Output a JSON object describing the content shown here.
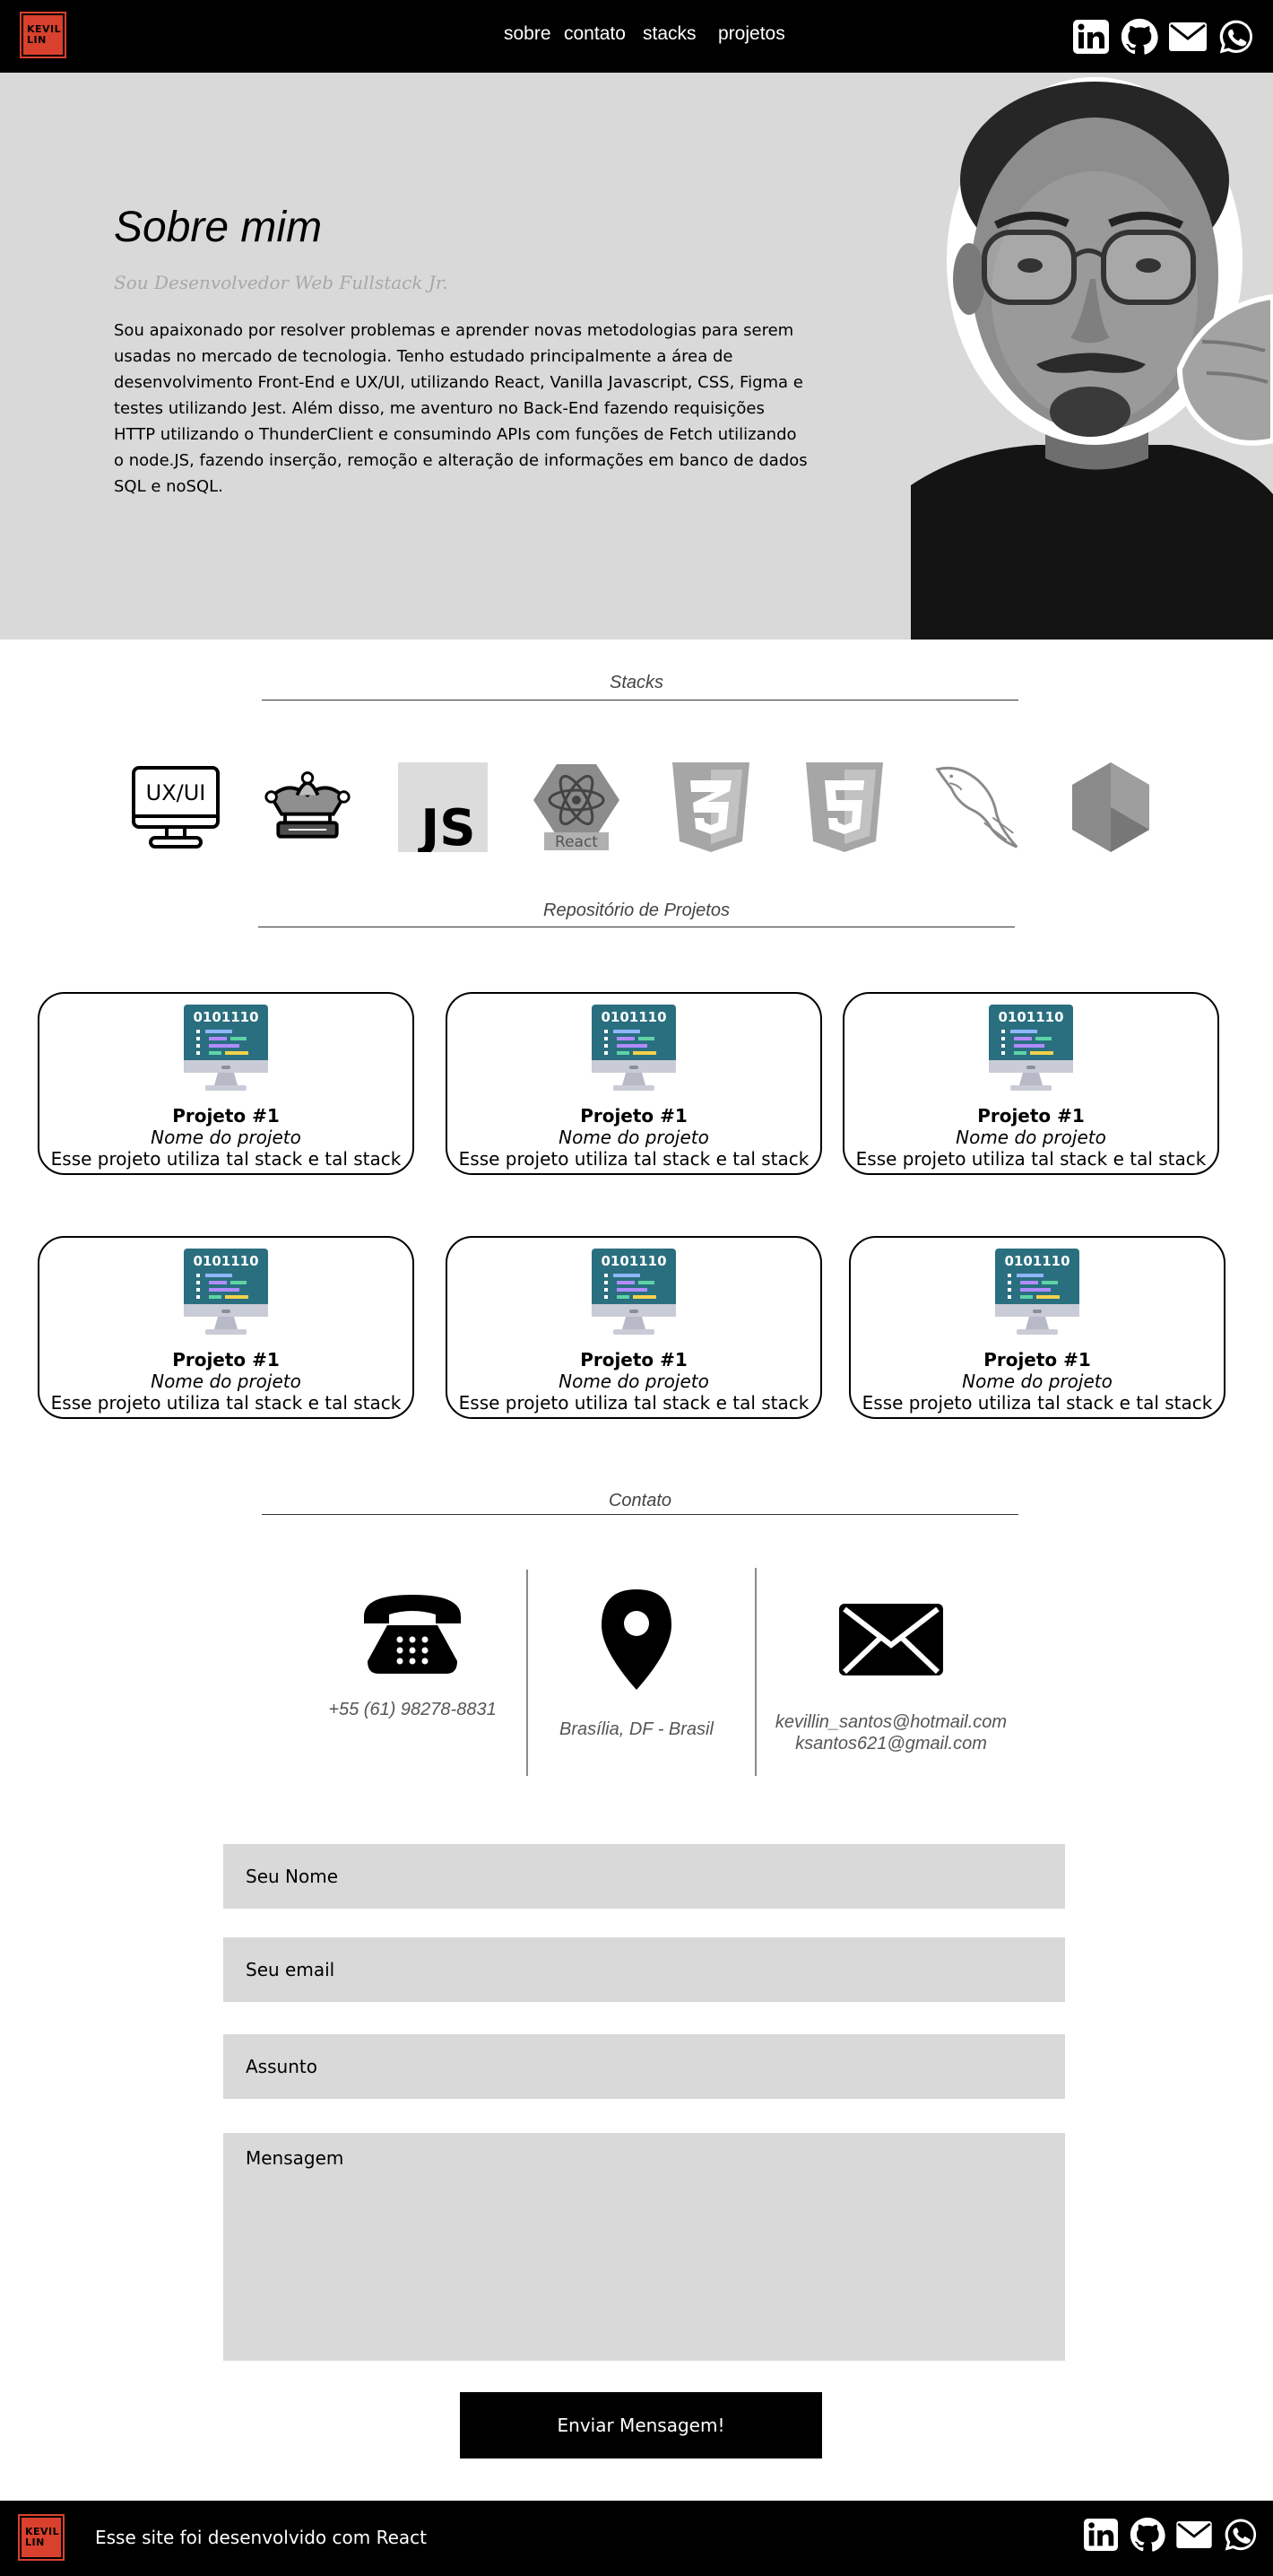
{
  "brand": {
    "logo_line1": "KEVIL",
    "logo_line2": "LIN"
  },
  "nav": {
    "items": [
      "sobre",
      "contato",
      "stacks",
      "projetos"
    ]
  },
  "social_icons": [
    "linkedin-icon",
    "github-icon",
    "mail-icon",
    "whatsapp-icon"
  ],
  "about": {
    "title": "Sobre mim",
    "subtitle": "Sou Desenvolvedor Web Fullstack Jr.",
    "text": "Sou apaixonado por resolver problemas e aprender novas metodologias para serem usadas no mercado de tecnologia. Tenho estudado principalmente a área de desenvolvimento Front-End e UX/UI, utilizando React, Vanilla Javascript, CSS, Figma e testes utilizando Jest. Além disso, me aventuro no Back-End fazendo requisições HTTP utilizando o ThunderClient e consumindo APIs com funções de Fetch utilizando o node.JS, fazendo inserção, remoção e alteração de informações em banco de dados SQL e noSQL."
  },
  "stacks": {
    "title": "Stacks",
    "ux_label": "UX/UI",
    "js_label": "JS",
    "react_label": "React",
    "icons": [
      "ux-ui-icon",
      "jest-icon",
      "javascript-icon",
      "react-icon",
      "css3-icon",
      "html5-icon",
      "mysql-icon",
      "nodejs-icon"
    ]
  },
  "projects": {
    "title": "Repositório de Projetos",
    "screen_text": "0101110",
    "items": [
      {
        "title": "Projeto #1",
        "name": "Nome do projeto",
        "desc": "Esse projeto utiliza tal stack e tal stack"
      },
      {
        "title": "Projeto #1",
        "name": "Nome do projeto",
        "desc": "Esse projeto utiliza tal stack e tal stack"
      },
      {
        "title": "Projeto #1",
        "name": "Nome do projeto",
        "desc": "Esse projeto utiliza tal stack e tal stack"
      },
      {
        "title": "Projeto #1",
        "name": "Nome do projeto",
        "desc": "Esse projeto utiliza tal stack e tal stack"
      },
      {
        "title": "Projeto #1",
        "name": "Nome do projeto",
        "desc": "Esse projeto utiliza tal stack e tal stack"
      },
      {
        "title": "Projeto #1",
        "name": "Nome do projeto",
        "desc": "Esse projeto utiliza tal stack e tal stack"
      }
    ]
  },
  "contact": {
    "title": "Contato",
    "phone": "+55 (61) 98278-8831",
    "location": "Brasília, DF - Brasil",
    "email1": "kevillin_santos@hotmail.com",
    "email2": "ksantos621@gmail.com"
  },
  "form": {
    "name_placeholder": "Seu Nome",
    "email_placeholder": "Seu email",
    "subject_placeholder": "Assunto",
    "message_placeholder": "Mensagem",
    "send_label": "Enviar Mensagem!"
  },
  "footer": {
    "text": "Esse site foi desenvolvido com React"
  },
  "colors": {
    "header_bg": "#000000",
    "section_bg": "#d9d9d9",
    "logo_red": "#d9412e",
    "card_screen": "#2a6f7f"
  }
}
